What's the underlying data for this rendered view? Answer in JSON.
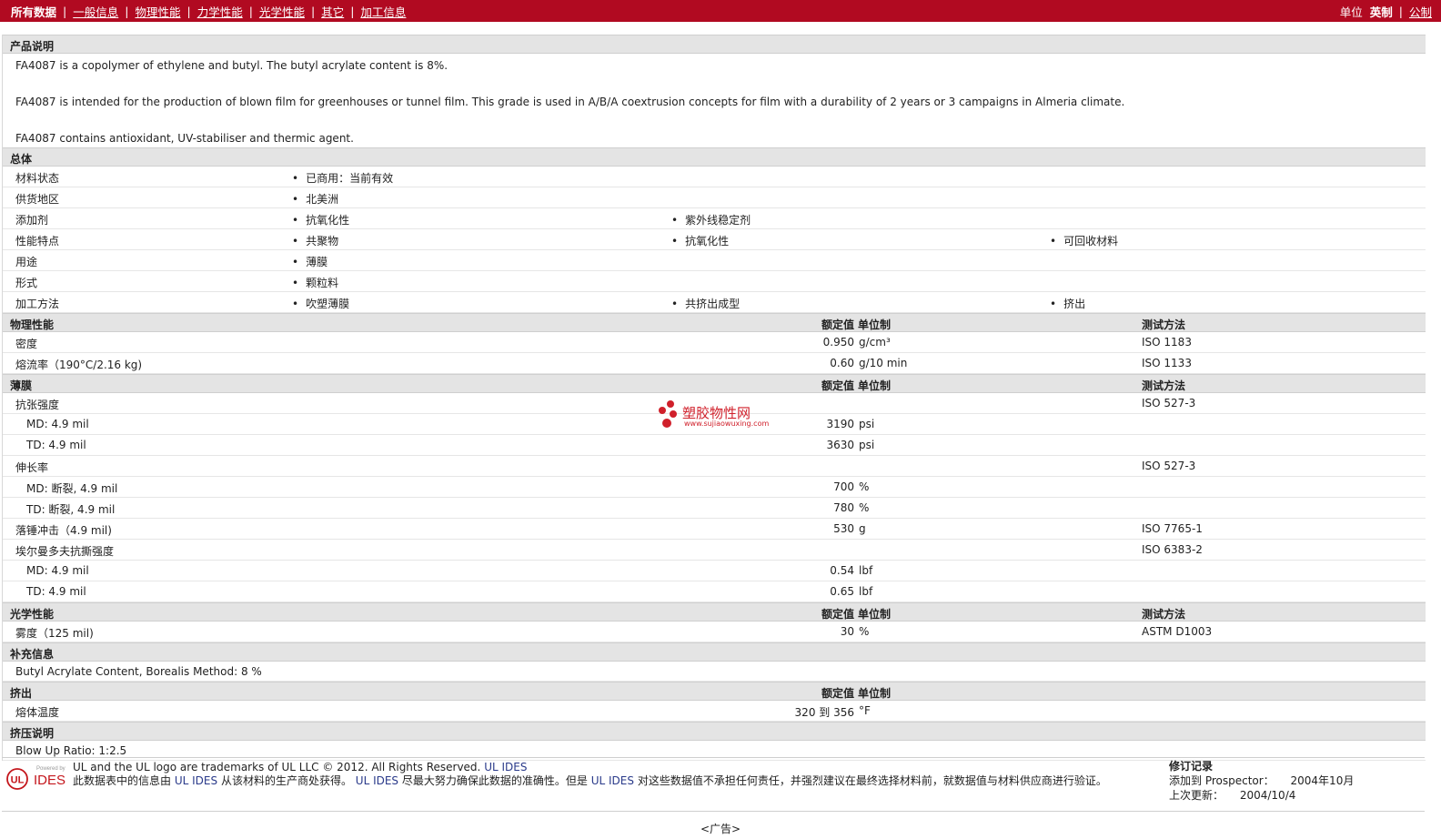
{
  "nav": {
    "items": [
      "所有数据",
      "一般信息",
      "物理性能",
      "力学性能",
      "光学性能",
      "其它",
      "加工信息"
    ],
    "units_label": "单位",
    "unit_options": [
      "英制",
      "公制"
    ]
  },
  "sections": {
    "product_desc": {
      "title": "产品说明",
      "paragraphs": [
        "FA4087 is a copolymer of ethylene and butyl. The butyl acrylate content is 8%.",
        "FA4087 is intended for the production of blown film for greenhouses or tunnel film. This grade is used in A/B/A coextrusion concepts for film with a durability of 2 years or 3 campaigns in Almeria climate.",
        "FA4087 contains antioxidant, UV-stabiliser and thermic agent."
      ]
    },
    "general": {
      "title": "总体",
      "rows": [
        {
          "label": "材料状态",
          "values": [
            "已商用：当前有效"
          ]
        },
        {
          "label": "供货地区",
          "values": [
            "北美洲"
          ]
        },
        {
          "label": "添加剂",
          "values": [
            "抗氧化性",
            "紫外线稳定剂"
          ]
        },
        {
          "label": "性能特点",
          "values": [
            "共聚物",
            "抗氧化性",
            "可回收材料"
          ]
        },
        {
          "label": "用途",
          "values": [
            "薄膜"
          ]
        },
        {
          "label": "形式",
          "values": [
            "颗粒料"
          ]
        },
        {
          "label": "加工方法",
          "values": [
            "吹塑薄膜",
            "共挤出成型",
            "挤出"
          ]
        }
      ]
    },
    "headers": {
      "nominal": "额定值",
      "unit": "单位制",
      "method": "测试方法"
    },
    "physical": {
      "title": "物理性能",
      "rows": [
        {
          "label": "密度",
          "value": "0.950",
          "unit": "g/cm³",
          "method": "ISO 1183"
        },
        {
          "label": "熔流率（190°C/2.16 kg)",
          "value": "0.60",
          "unit": "g/10 min",
          "method": "ISO 1133"
        }
      ]
    },
    "film": {
      "title": "薄膜",
      "rows": [
        {
          "label": "抗张强度",
          "value": "",
          "unit": "",
          "method": "ISO 527-3",
          "sub": false
        },
        {
          "label": "MD: 4.9 mil",
          "value": "3190",
          "unit": "psi",
          "method": "",
          "sub": true
        },
        {
          "label": "TD: 4.9 mil",
          "value": "3630",
          "unit": "psi",
          "method": "",
          "sub": true
        },
        {
          "label": "伸长率",
          "value": "",
          "unit": "",
          "method": "ISO 527-3",
          "sub": false
        },
        {
          "label": "MD: 断裂, 4.9 mil",
          "value": "700",
          "unit": "%",
          "method": "",
          "sub": true
        },
        {
          "label": "TD: 断裂, 4.9 mil",
          "value": "780",
          "unit": "%",
          "method": "",
          "sub": true
        },
        {
          "label": "落锤冲击（4.9 mil)",
          "value": "530",
          "unit": "g",
          "method": "ISO 7765-1",
          "sub": false
        },
        {
          "label": "埃尔曼多夫抗撕强度",
          "value": "",
          "unit": "",
          "method": "ISO 6383-2",
          "sub": false
        },
        {
          "label": "MD: 4.9 mil",
          "value": "0.54",
          "unit": "lbf",
          "method": "",
          "sub": true
        },
        {
          "label": "TD: 4.9 mil",
          "value": "0.65",
          "unit": "lbf",
          "method": "",
          "sub": true
        }
      ]
    },
    "optical": {
      "title": "光学性能",
      "rows": [
        {
          "label": "雾度（125 mil)",
          "value": "30",
          "unit": "%",
          "method": "ASTM D1003"
        }
      ]
    },
    "supplement": {
      "title": "补充信息",
      "text": "Butyl Acrylate Content, Borealis Method: 8 %"
    },
    "extrusion": {
      "title": "挤出",
      "rows": [
        {
          "label": "熔体温度",
          "value": "320 到  356",
          "unit": "°F",
          "method": ""
        }
      ]
    },
    "extrusion_note": {
      "title": "挤压说明",
      "text": "Blow Up Ratio: 1:2.5"
    }
  },
  "footer": {
    "logo_small": "Powered by",
    "logo_ul": "UL",
    "logo_ides": "IDES",
    "line1": "UL and the UL logo are trademarks of UL LLC © 2012. All Rights Reserved.",
    "line1_link": "UL IDES",
    "line2a": "此数据表中的信息由",
    "brand": "UL IDES",
    "line2b": "从该材料的生产商处获得。",
    "line2c": "尽最大努力确保此数据的准确性。但是",
    "line2d": "对这些数据值不承担任何责任，并强烈建议在最终选择材料前，就数据值与材料供应商进行验证。",
    "revision_title": "修订记录",
    "added_label": "添加到  Prospector：",
    "added_value": "2004年10月",
    "updated_label": "上次更新：",
    "updated_value": "2004/10/4"
  },
  "ad_label": "<广告>",
  "watermark": {
    "name": "塑胶物性网",
    "url": "www.sujiaowuxing.com"
  },
  "colors": {
    "topbar": "#b10a21",
    "section_bg": "#e4e4e4",
    "ul_red": "#c4161c",
    "watermark": "#d0202b"
  }
}
